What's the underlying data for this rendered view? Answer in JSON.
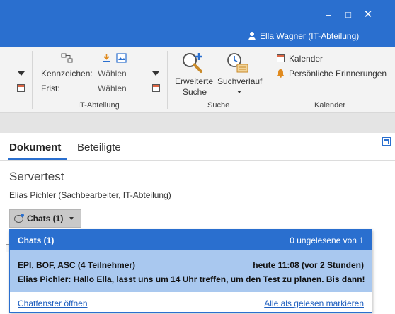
{
  "window": {
    "minimize_glyph": "–",
    "maximize_glyph": "□",
    "close_glyph": "✕",
    "user": "Ella Wagner (IT-Abteilung)"
  },
  "ribbon": {
    "it_group": {
      "kennzeichen_label": "Kennzeichen:",
      "kennzeichen_value": "Wählen",
      "frist_label": "Frist:",
      "frist_value": "Wählen",
      "group_label": "IT-Abteilung"
    },
    "suche_group": {
      "erweiterte_line1": "Erweiterte",
      "erweiterte_line2": "Suche",
      "suchverlauf": "Suchverlauf",
      "group_label": "Suche"
    },
    "kalender_group": {
      "kalender": "Kalender",
      "erinnerungen": "Persönliche Erinnerungen",
      "group_label": "Kalender"
    }
  },
  "tabs": [
    {
      "label": "Dokument"
    },
    {
      "label": "Beteiligte"
    }
  ],
  "document": {
    "title": "Servertest",
    "subtitle": "Elias Pichler (Sachbearbeiter, IT-Abteilung)"
  },
  "chats_button": {
    "label": "Chats (1)"
  },
  "popup": {
    "header_left": "Chats (1)",
    "header_right": "0 ungelesene von 1",
    "item": {
      "participants": "EPI, BOF, ASC (4 Teilnehmer)",
      "time": "heute 11:08 (vor 2 Stunden)",
      "message": "Elias Pichler: Hallo Ella, lasst uns um 14 Uhr treffen, um den Test zu planen. Bis dann!"
    },
    "open_link": "Chatfenster öffnen",
    "mark_read_link": "Alle als gelesen markieren"
  },
  "colors": {
    "accent": "#2a6fcf",
    "selected_item": "#a9c8ef"
  }
}
